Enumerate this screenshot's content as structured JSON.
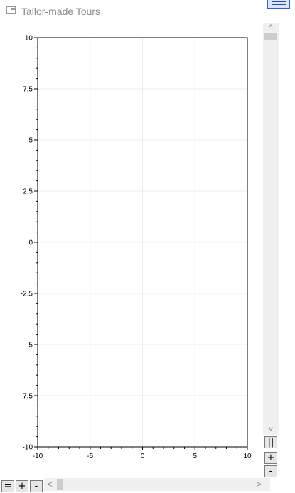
{
  "window": {
    "title": "Tailor-made Tours",
    "icon": "app-window-icon",
    "system_button_icon": "window-menu-icon"
  },
  "chart_data": {
    "type": "line",
    "title": "",
    "xlabel": "",
    "ylabel": "",
    "xlim": [
      -10,
      10
    ],
    "ylim": [
      -10,
      10
    ],
    "x_ticks": [
      "-10",
      "-5",
      "0",
      "5",
      "10"
    ],
    "y_ticks": [
      "10",
      "7.5",
      "5",
      "2.5",
      "0",
      "-2.5",
      "-5",
      "-7.5",
      "-10"
    ],
    "grid": true,
    "series": []
  },
  "vscroll": {
    "up_glyph": "^",
    "down_glyph": "v"
  },
  "hscroll": {
    "left_glyph": "<",
    "right_glyph": ">"
  },
  "zoom_controls": {
    "vertical": {
      "pause": "||",
      "zoom_in": "+",
      "zoom_out": "-"
    },
    "horizontal": {
      "reset": "=",
      "zoom_in": "+",
      "zoom_out": "-"
    }
  }
}
